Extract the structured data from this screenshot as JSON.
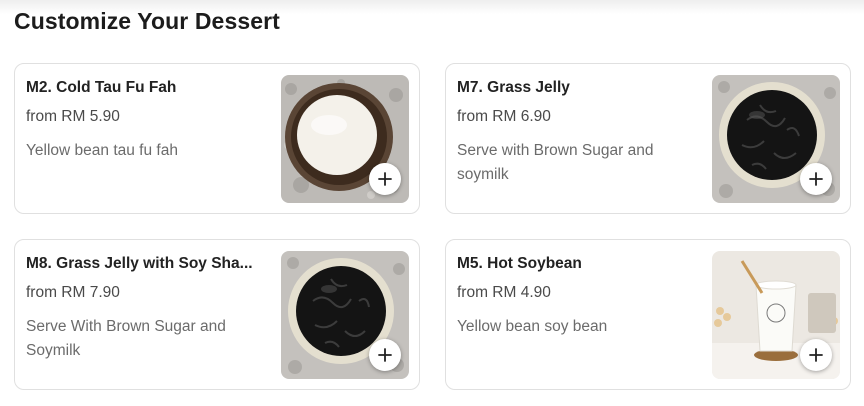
{
  "section": {
    "title": "Customize Your Dessert"
  },
  "items": [
    {
      "name": "M2. Cold Tau Fu Fah",
      "price": "from RM 5.90",
      "description": "Yellow bean tau fu fah",
      "image": "tau-fu-fah-bowl"
    },
    {
      "name": "M7. Grass Jelly",
      "price": "from RM 6.90",
      "description": "Serve with Brown Sugar and soymilk",
      "image": "grass-jelly-bowl"
    },
    {
      "name": "M8. Grass Jelly with Soy Sha...",
      "price": "from RM 7.90",
      "description": "Serve With Brown Sugar and Soymilk",
      "image": "grass-jelly-bowl"
    },
    {
      "name": "M5. Hot Soybean",
      "price": "from RM 4.90",
      "description": "Yellow bean soy bean",
      "image": "soybean-cup"
    }
  ],
  "icons": {
    "add": "plus-icon"
  },
  "colors": {
    "text": "#222222",
    "muted": "#6b6b6b",
    "border": "#e0e0e0"
  }
}
